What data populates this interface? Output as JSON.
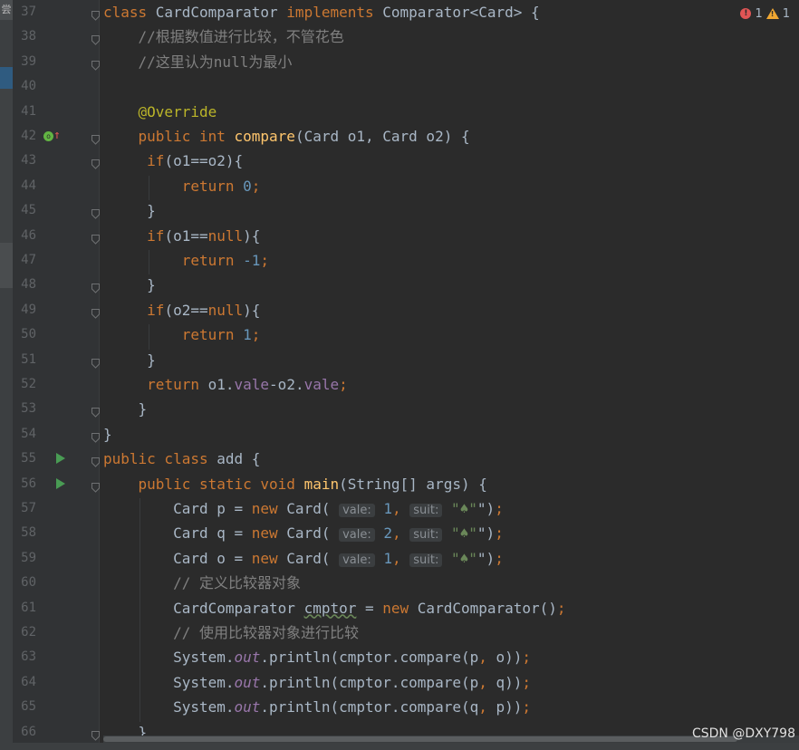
{
  "inspections": {
    "errors": "1",
    "warnings": "1",
    "error_icon": "error-icon",
    "warning_icon": "warning-icon"
  },
  "watermark": "CSDN @DXY798",
  "left_strip_glyph": "尝",
  "lines": [
    {
      "n": "37",
      "t": [
        [
          "kw",
          "class "
        ],
        [
          "",
          "CardComparator "
        ],
        [
          "kw",
          "implements "
        ],
        [
          "",
          "Comparator<Card> {"
        ]
      ]
    },
    {
      "n": "38",
      "t": [
        [
          "",
          "    "
        ],
        [
          "cm",
          "//根据数值进行比较，不管花色"
        ]
      ]
    },
    {
      "n": "39",
      "t": [
        [
          "",
          "    "
        ],
        [
          "cm",
          "//这里认为null为最小"
        ]
      ]
    },
    {
      "n": "40",
      "t": []
    },
    {
      "n": "41",
      "t": [
        [
          "",
          "    "
        ],
        [
          "ann",
          "@Override"
        ]
      ]
    },
    {
      "n": "42",
      "t": [
        [
          "",
          "    "
        ],
        [
          "kw",
          "public int "
        ],
        [
          "fn",
          "compare"
        ],
        [
          "",
          "(Card o1, Card o2) {"
        ]
      ]
    },
    {
      "n": "43",
      "t": [
        [
          "",
          "     "
        ],
        [
          "kw",
          "if"
        ],
        [
          "",
          "(o1==o2){"
        ]
      ]
    },
    {
      "n": "44",
      "t": [
        [
          "",
          "         "
        ],
        [
          "kw",
          "return "
        ],
        [
          "num",
          "0"
        ],
        [
          "kw",
          ";"
        ]
      ]
    },
    {
      "n": "45",
      "t": [
        [
          "",
          "     }"
        ]
      ]
    },
    {
      "n": "46",
      "t": [
        [
          "",
          "     "
        ],
        [
          "kw",
          "if"
        ],
        [
          "",
          "(o1=="
        ],
        [
          "kw",
          "null"
        ],
        [
          "",
          "){"
        ]
      ]
    },
    {
      "n": "47",
      "t": [
        [
          "",
          "         "
        ],
        [
          "kw",
          "return "
        ],
        [
          "num",
          "-1"
        ],
        [
          "kw",
          ";"
        ]
      ]
    },
    {
      "n": "48",
      "t": [
        [
          "",
          "     }"
        ]
      ]
    },
    {
      "n": "49",
      "t": [
        [
          "",
          "     "
        ],
        [
          "kw",
          "if"
        ],
        [
          "",
          "(o2=="
        ],
        [
          "kw",
          "null"
        ],
        [
          "",
          "){"
        ]
      ]
    },
    {
      "n": "50",
      "t": [
        [
          "",
          "         "
        ],
        [
          "kw",
          "return "
        ],
        [
          "num",
          "1"
        ],
        [
          "kw",
          ";"
        ]
      ]
    },
    {
      "n": "51",
      "t": [
        [
          "",
          "     }"
        ]
      ]
    },
    {
      "n": "52",
      "t": [
        [
          "",
          "     "
        ],
        [
          "kw",
          "return "
        ],
        [
          "",
          "o1."
        ],
        [
          "field",
          "vale"
        ],
        [
          "",
          "-o2."
        ],
        [
          "field",
          "vale"
        ],
        [
          "kw",
          ";"
        ]
      ]
    },
    {
      "n": "53",
      "t": [
        [
          "",
          "    }"
        ]
      ]
    },
    {
      "n": "54",
      "t": [
        [
          "",
          "}"
        ]
      ]
    },
    {
      "n": "55",
      "t": [
        [
          "kw",
          "public class "
        ],
        [
          "",
          "add {"
        ]
      ]
    },
    {
      "n": "56",
      "t": [
        [
          "",
          "    "
        ],
        [
          "kw",
          "public static void "
        ],
        [
          "fn",
          "main"
        ],
        [
          "",
          "(String[] args) {"
        ]
      ]
    },
    {
      "n": "57",
      "t": [
        [
          "",
          "        Card p = "
        ],
        [
          "kw",
          "new "
        ],
        [
          "",
          "Card( "
        ],
        [
          "hint",
          "vale:"
        ],
        [
          "num",
          " 1"
        ],
        [
          "kw",
          ", "
        ],
        [
          "hint",
          "suit:"
        ],
        [
          "str",
          " \"♠\""
        ],
        [
          "",
          "\")"
        ],
        [
          "kw",
          ";"
        ]
      ]
    },
    {
      "n": "58",
      "t": [
        [
          "",
          "        Card q = "
        ],
        [
          "kw",
          "new "
        ],
        [
          "",
          "Card( "
        ],
        [
          "hint",
          "vale:"
        ],
        [
          "num",
          " 2"
        ],
        [
          "kw",
          ", "
        ],
        [
          "hint",
          "suit:"
        ],
        [
          "str",
          " \"♠\""
        ],
        [
          "",
          "\")"
        ],
        [
          "kw",
          ";"
        ]
      ]
    },
    {
      "n": "59",
      "t": [
        [
          "",
          "        Card o = "
        ],
        [
          "kw",
          "new "
        ],
        [
          "",
          "Card( "
        ],
        [
          "hint",
          "vale:"
        ],
        [
          "num",
          " 1"
        ],
        [
          "kw",
          ", "
        ],
        [
          "hint",
          "suit:"
        ],
        [
          "str",
          " \"♠\""
        ],
        [
          "",
          "\")"
        ],
        [
          "kw",
          ";"
        ]
      ]
    },
    {
      "n": "60",
      "t": [
        [
          "",
          "        "
        ],
        [
          "cm",
          "// 定义比较器对象"
        ]
      ]
    },
    {
      "n": "61",
      "t": [
        [
          "",
          "        CardComparator "
        ],
        [
          "warn",
          "cmptor"
        ],
        [
          "",
          " = "
        ],
        [
          "kw",
          "new "
        ],
        [
          "",
          "CardComparator()"
        ],
        [
          "kw",
          ";"
        ]
      ]
    },
    {
      "n": "62",
      "t": [
        [
          "",
          "        "
        ],
        [
          "cm",
          "// 使用比较器对象进行比较"
        ]
      ]
    },
    {
      "n": "63",
      "t": [
        [
          "",
          "        System."
        ],
        [
          "static",
          "out"
        ],
        [
          "",
          ".println(cmptor.compare(p"
        ],
        [
          "kw",
          ", "
        ],
        [
          "",
          "o))"
        ],
        [
          "kw",
          ";"
        ]
      ]
    },
    {
      "n": "64",
      "t": [
        [
          "",
          "        System."
        ],
        [
          "static",
          "out"
        ],
        [
          "",
          ".println(cmptor.compare(p"
        ],
        [
          "kw",
          ", "
        ],
        [
          "",
          "q))"
        ],
        [
          "kw",
          ";"
        ]
      ]
    },
    {
      "n": "65",
      "t": [
        [
          "",
          "        System."
        ],
        [
          "static",
          "out"
        ],
        [
          "",
          ".println(cmptor.compare(q"
        ],
        [
          "kw",
          ", "
        ],
        [
          "",
          "p))"
        ],
        [
          "kw",
          ";"
        ]
      ]
    },
    {
      "n": "66",
      "t": [
        [
          "",
          "    }"
        ]
      ]
    }
  ],
  "gutter_markers": {
    "run_lines": [
      "55",
      "56"
    ],
    "override_line": "42"
  }
}
